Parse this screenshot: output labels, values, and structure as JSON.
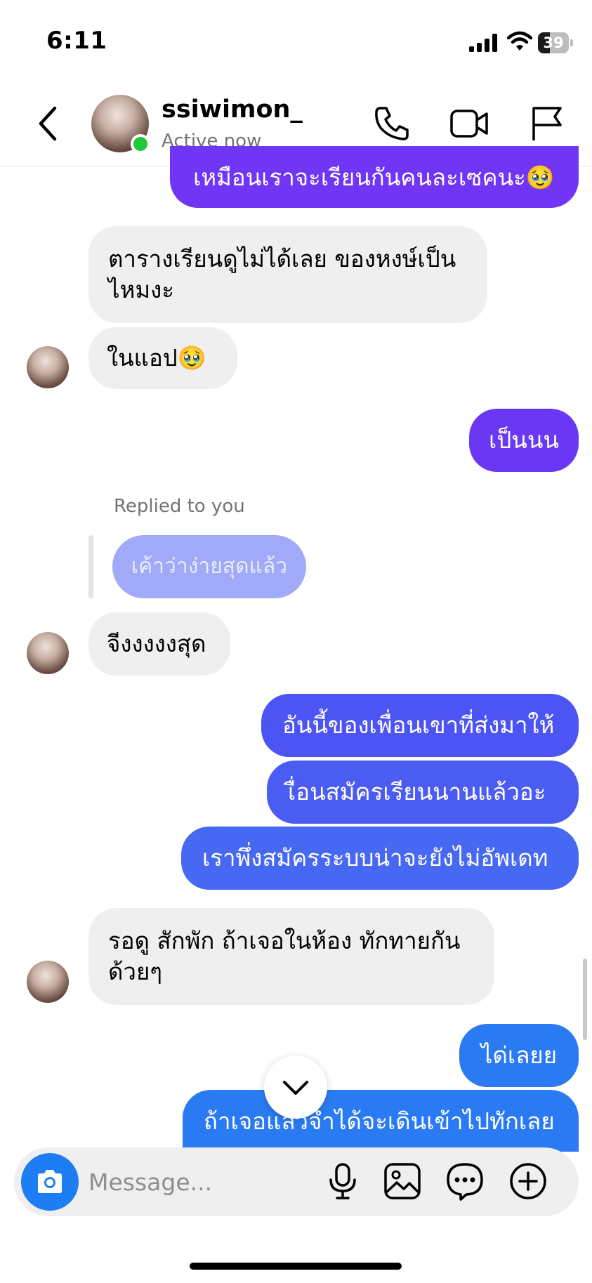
{
  "status_bar": {
    "time": "6:11",
    "battery_percent": "39",
    "battery_level": 0.39
  },
  "header": {
    "contact_name": "ssiwimon_",
    "contact_status": "Active now",
    "icons": [
      "back-chevron-icon",
      "phone-icon",
      "video-camera-icon",
      "flag-icon"
    ]
  },
  "messages": {
    "m0": "เหมือนเราจะเรียนกันคนละเซคนะ🥹",
    "m1_line1": "ตารางเรียนดูไม่ได้เลย ของหงษ์เป็น",
    "m1_line2": "ไหมงะ",
    "m2": "ในแอป🥹",
    "m3": "เป็นนน",
    "reply_label": "Replied to you",
    "reply_quote": "เค้าว่าง่ายสุดแล้ว",
    "m4": "จีงงงงงสุด",
    "m5": "อันนี้ของเพื่อนเขาที่ส่งมาให้",
    "m6": "เื่อนสมัครเรียนนานแล้วอะ",
    "m7": "เราพึ่งสมัครระบบน่าจะยังไม่อัพเดท",
    "m8_line1": "รอดู สักพัก ถ้าเจอในห้อง ทักทายกัน",
    "m8_line2": "ด้วยๆ",
    "m9": "ได่เลยย",
    "m10": "ถ้าเจอแล้วจำได้จะเดินเข้าไปทักเลย"
  },
  "composer": {
    "placeholder": "Message...",
    "icons": [
      "camera-icon",
      "microphone-icon",
      "gallery-icon",
      "sticker-icon",
      "plus-icon"
    ]
  },
  "colors": {
    "purple_bubble": "#7035f5",
    "indigo_bubble": "#4c55f3",
    "blue_bubble": "#2a7bf3",
    "incoming_bubble": "#efefef",
    "online": "#1fc93a"
  }
}
